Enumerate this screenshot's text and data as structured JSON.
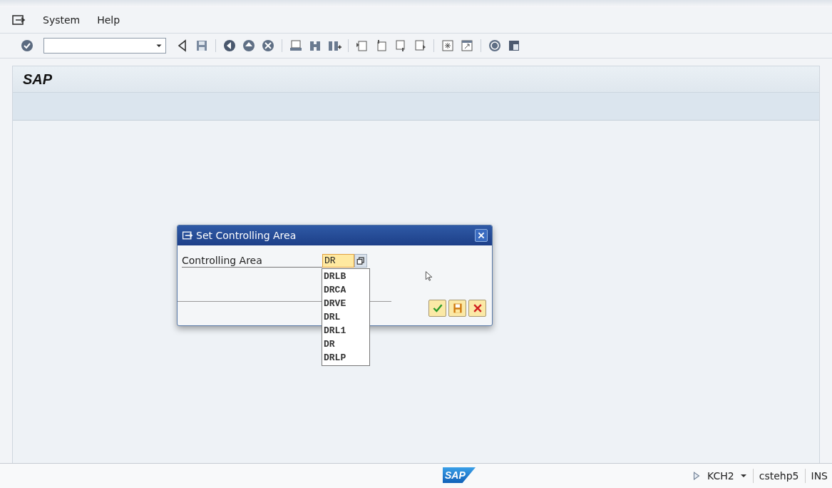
{
  "menu": [
    {
      "label": "System"
    },
    {
      "label": "Help"
    }
  ],
  "screen": {
    "title": "SAP"
  },
  "dialog": {
    "title": "Set Controlling Area",
    "field_label": "Controlling Area",
    "field_value": "DR",
    "suggestions": [
      "DRLB",
      "DRCA",
      "DRVE",
      "DRL",
      "DRL1",
      "DR",
      "DRLP"
    ],
    "buttons": [
      {
        "kind": "confirm"
      },
      {
        "kind": "save"
      },
      {
        "kind": "cancel"
      }
    ]
  },
  "status_bar": {
    "logo": "SAP",
    "system": "KCH2",
    "server": "cstehp5",
    "mode": "INS"
  }
}
